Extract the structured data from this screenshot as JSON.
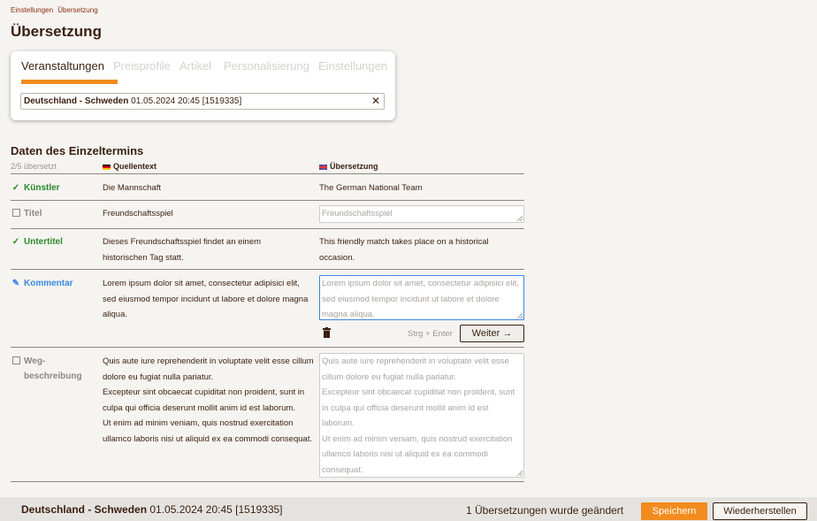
{
  "breadcrumb": [
    "Einstellungen",
    "Übersetzung"
  ],
  "page_title": "Übersetzung",
  "tabs": [
    {
      "label": "Veranstaltungen",
      "active": true
    },
    {
      "label": "Preisprofile",
      "active": false
    },
    {
      "label": "Artikel",
      "active": false
    },
    {
      "label": "Personalisierung",
      "active": false
    },
    {
      "label": "Einstellungen",
      "active": false
    }
  ],
  "event_select": {
    "name": "Deutschland - Schweden",
    "details": "01.05.2024 20:45 [1519335]"
  },
  "section_title": "Daten des Einzeltermins",
  "table_head": {
    "count": "2/5 übersetzt",
    "source": "Quellentext",
    "translation": "Übersetzung"
  },
  "rows": [
    {
      "label": "Künstler",
      "state": "done",
      "source": "Die Mannschaft",
      "translation": "The German National Team"
    },
    {
      "label": "Titel",
      "state": "todo",
      "source": "Freundschaftsspiel",
      "translation_placeholder": "Freundschaftsspiel"
    },
    {
      "label": "Untertitel",
      "state": "done",
      "source_l1": "Dieses Freundschaftsspiel findet an einem",
      "source_l2": "historischen Tag statt.",
      "translation_l1": "This friendly match takes place on a historical",
      "translation_l2": "occasion."
    },
    {
      "label": "Kommentar",
      "state": "edit",
      "source": "Lorem ipsum dolor sit amet, consectetur adipisici elit, sed eiusmod tempor incidunt ut labore et dolore magna aliqua.",
      "translation_placeholder": "Lorem ipsum dolor sit amet, consectetur adipisici elit, sed eiusmod tempor incidunt ut labore et dolore magna aliqua."
    },
    {
      "label_l1": "Weg-",
      "label_l2": "beschreibung",
      "state": "todo",
      "source": "Quis aute iure reprehenderit in voluptate velit esse cillum dolore eu fugiat nulla pariatur.\nExcepteur sint obcaecat cupiditat non proident, sunt in culpa qui officia deserunt mollit anim id est laborum.\nUt enim ad minim veniam, quis nostrud exercitation ullamco laboris nisi ut aliquid ex ea commodi consequat.",
      "translation_placeholder": "Quis aute iure reprehenderit in voluptate velit esse cillum dolore eu fugiat nulla pariatur.\nExcepteur sint obcaecat cupiditat non proident, sunt in culpa qui officia deserunt mollit anim id est laborum.\nUt enim ad minim veniam, quis nostrud exercitation ullamco laboris nisi ut aliquid ex ea commodi consequat."
    }
  ],
  "actions": {
    "shortcut_hint": "Strg + Enter",
    "next_label": "Weiter"
  },
  "footer": {
    "event_name": "Deutschland - Schweden",
    "event_details": "01.05.2024 20:45 [1519335]",
    "status": "1 Übersetzungen wurde geändert",
    "save_label": "Speichern",
    "reset_label": "Wiederherstellen"
  },
  "colors": {
    "accent": "#f28c1e",
    "done": "#2a8a2a",
    "edit": "#3a86e0",
    "text": "#3a1f0f"
  }
}
